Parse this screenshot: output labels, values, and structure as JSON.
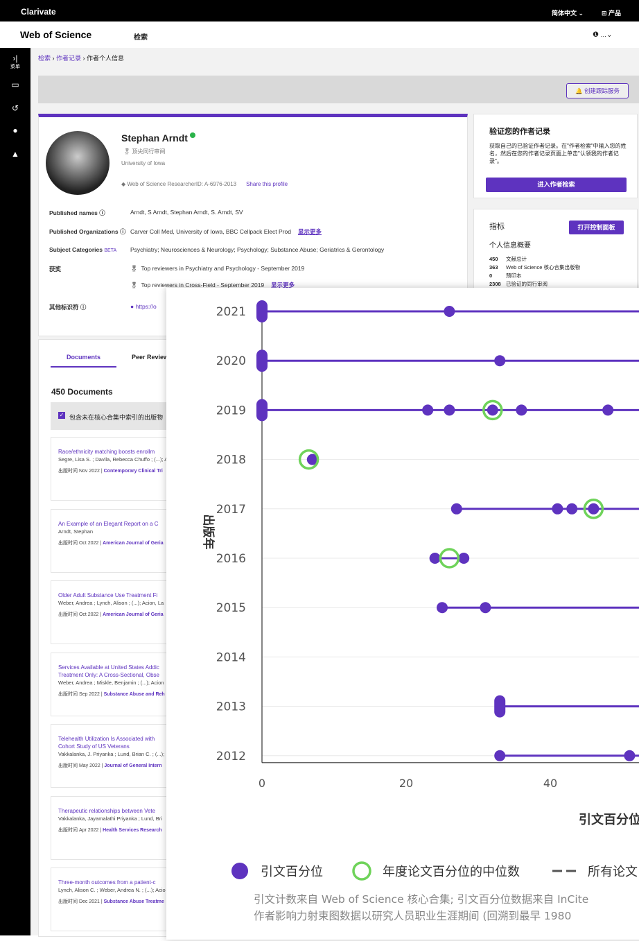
{
  "topbar": {
    "logo": "Clarivate",
    "lang": "简体中文 ⌄",
    "products": "⊞ 产品"
  },
  "header": {
    "brand": "Web of Science",
    "search": "检索",
    "user": "❶ ...⌄"
  },
  "leftrail": {
    "menu": "菜单"
  },
  "breadcrumb": {
    "search": "检索",
    "author_record": "作者记录",
    "current": "作者个人信息"
  },
  "banner": {
    "track_btn": "🔔 创建跟踪服务"
  },
  "profile": {
    "name": "Stephan Arndt",
    "peer": "顶尖同行审阅",
    "university": "University of Iowa",
    "researcher_id": "Web of Science ResearcherID: A-6976-2013",
    "share": "Share this profile",
    "published_names_k": "Published names ⓘ",
    "published_names_v": "Arndt, S    Arndt, Stephan    Arndt, S.    Arndt, SV",
    "orgs_k": "Published Organizations ⓘ",
    "orgs_v": "Carver Coll Med, University of Iowa, BBC Cellpack Elect Prod",
    "show_more": "显示更多",
    "subj_k": "Subject Categories",
    "subj_beta": "BETA",
    "subj_v": "Psychiatry; Neurosciences & Neurology; Psychology; Substance Abuse; Geriatrics & Gerontology",
    "awards_k": "获奖",
    "award1": "Top reviewers in Psychiatry and Psychology - September 2019",
    "award2": "Top reviewers in Cross-Field - September 2019",
    "other_k": "其他标识符 ⓘ",
    "other_v": "https://o"
  },
  "verify": {
    "title": "验证您的作者记录",
    "desc": "获取自己的已验证作者记录。在\"作者检索\"中输入您的姓名，然后在您的作者记录页面上单击\"认领我的作者记录\"。",
    "button": "进入作者检索"
  },
  "metrics": {
    "title": "指标",
    "button": "打开控制面板",
    "subtitle": "个人信息概要",
    "rows": [
      {
        "n": "450",
        "l": "文献总计"
      },
      {
        "n": "363",
        "l": "Web of Science 核心合集出版物"
      },
      {
        "n": "0",
        "l": "预印本"
      },
      {
        "n": "2308",
        "l": "已验证的同行审阅"
      }
    ]
  },
  "docs": {
    "tab1": "Documents",
    "tab2": "Peer Review",
    "count": "450 Documents",
    "filter": "包含未在核心合集中索引的出版物",
    "items": [
      {
        "title": "Race/ethnicity matching boosts enrollm",
        "authors": "Segre, Lisa S. ; Davila, Rebecca Chuffo ; (...); A",
        "pub": "出版时间 Nov 2022 | ",
        "journal": "Contemporary Clinical Tri"
      },
      {
        "title": "An Example of an Elegant Report on a C",
        "authors": "Arndt, Stephan",
        "pub": "出版时间 Oct 2022 | ",
        "journal": "American Journal of Geria"
      },
      {
        "title": "Older Adult Substance Use Treatment Fi",
        "authors": "Weber, Andrea ; Lynch, Alison ; (...); Acion, La",
        "pub": "出版时间 Oct 2022 | ",
        "journal": "American Journal of Geria"
      },
      {
        "title": "Services Available at United States Addic\nTreatment Only: A Cross-Sectional, Obse",
        "authors": "Weber, Andrea ; Miskle, Benjamin ; (...); Acion",
        "pub": "出版时间 Sep 2022 | ",
        "journal": "Substance Abuse and Reh"
      },
      {
        "title": "Telehealth Utilization Is Associated with\nCohort Study of US Veterans",
        "authors": "Vakkalanka, J. Priyanka ; Lund, Brian C. ; (...);",
        "pub": "出版时间 May 2022 | ",
        "journal": "Journal of General Intern"
      },
      {
        "title": "Therapeutic relationships between Vete",
        "authors": "Vakkalanka, Jayamalathi Priyanka ; Lund, Bri",
        "pub": "出版时间 Apr 2022 | ",
        "journal": "Health Services Research"
      },
      {
        "title": "Three-month outcomes from a patient-c",
        "authors": "Lynch, Alison C. ; Weber, Andrea N. ; (...); Acio",
        "pub": "出版时间 Dec 2021 | ",
        "journal": "Substance Abuse Treatme"
      }
    ]
  },
  "chart_data": {
    "type": "scatter",
    "xlabel": "引文百分位",
    "ylabel": "出版年",
    "x_ticks": [
      0,
      20,
      40
    ],
    "categories": [
      "2021",
      "2020",
      "2019",
      "2018",
      "2017",
      "2016",
      "2015",
      "2014",
      "2013",
      "2012"
    ],
    "series": [
      {
        "name": "引文百分位",
        "points": {
          "2021": [
            0,
            26.0
          ],
          "2020": [
            0,
            33
          ],
          "2019": [
            0,
            23,
            26,
            32,
            36,
            48
          ],
          "2018": [
            7
          ],
          "2017": [
            27,
            41,
            43,
            46
          ],
          "2016": [
            24,
            28
          ],
          "2015": [
            25,
            31
          ],
          "2014": [],
          "2013": [
            33
          ],
          "2012": [
            33,
            51
          ]
        }
      },
      {
        "name": "年度论文百分位的中位数",
        "points": {
          "2019": 32,
          "2018": 6.5,
          "2017": 46,
          "2016": 26
        }
      }
    ],
    "legend": [
      "引文百分位",
      "年度论文百分位的中位数",
      "所有论文"
    ],
    "footnote1": "引文计数来自 Web of Science 核心合集; 引文百分位数据来自 InCite",
    "footnote2": "作者影响力射束图数据以研究人员职业生涯期间 (回溯到最早 1980"
  },
  "colors": {
    "accent": "#5e33bf",
    "median": "#6fd35a"
  }
}
